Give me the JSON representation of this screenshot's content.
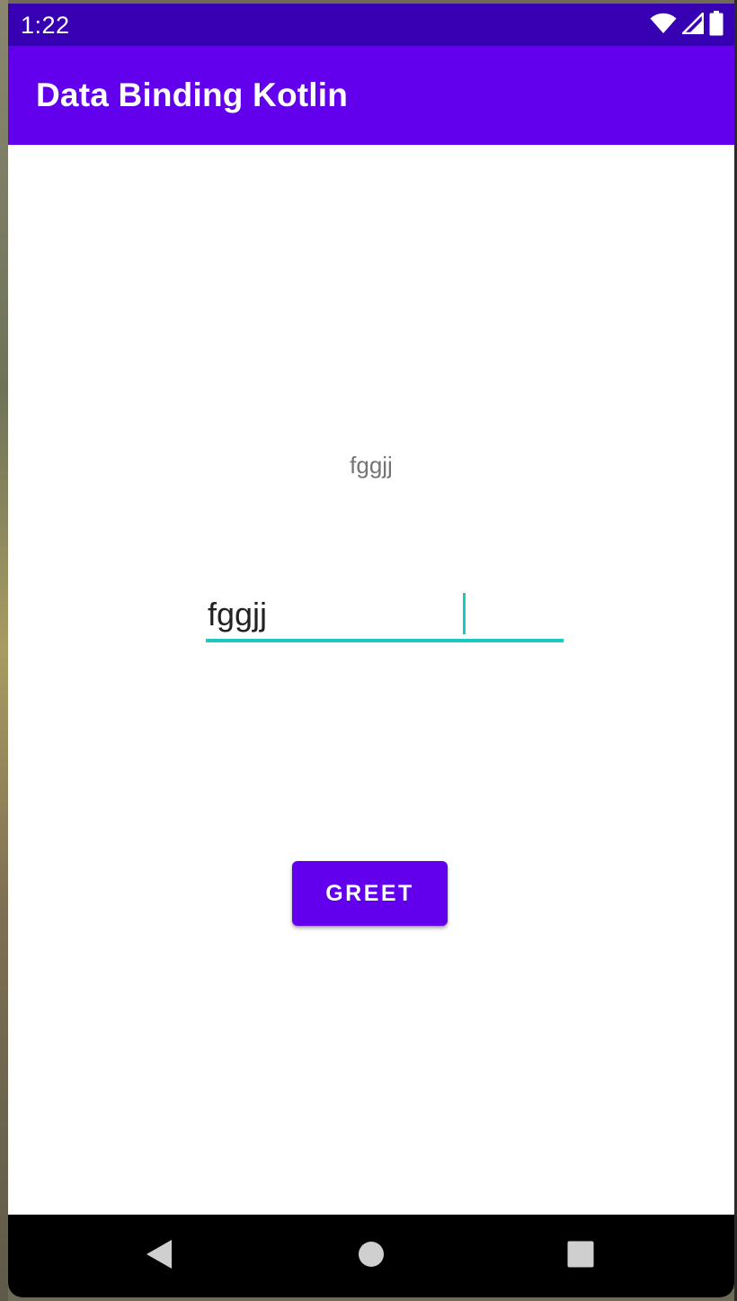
{
  "status_bar": {
    "time": "1:22",
    "icons": [
      "wifi-icon",
      "cellular-signal-icon",
      "battery-icon"
    ]
  },
  "app_bar": {
    "title": "Data Binding Kotlin",
    "color": "#6200ee",
    "status_color": "#3700b3"
  },
  "main": {
    "greeting_text": "fggjj",
    "name_input": {
      "value": "fggjj",
      "focused": true,
      "accent_color": "#1ac9c0"
    },
    "greet_button": {
      "label": "GREET"
    }
  },
  "nav_bar": {
    "icons": [
      "back-icon",
      "home-icon",
      "recents-icon"
    ]
  }
}
